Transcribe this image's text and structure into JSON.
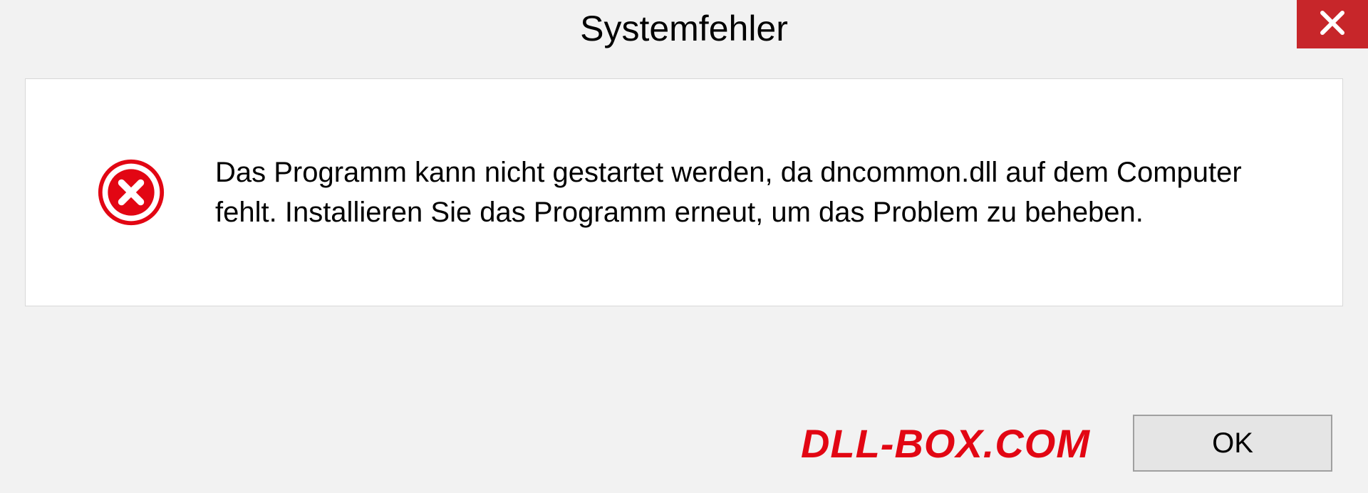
{
  "dialog": {
    "title": "Systemfehler",
    "message": "Das Programm kann nicht gestartet werden, da dncommon.dll auf dem Computer fehlt. Installieren Sie das Programm erneut, um das Problem zu beheben.",
    "ok_label": "OK"
  },
  "watermark": "DLL-BOX.COM"
}
